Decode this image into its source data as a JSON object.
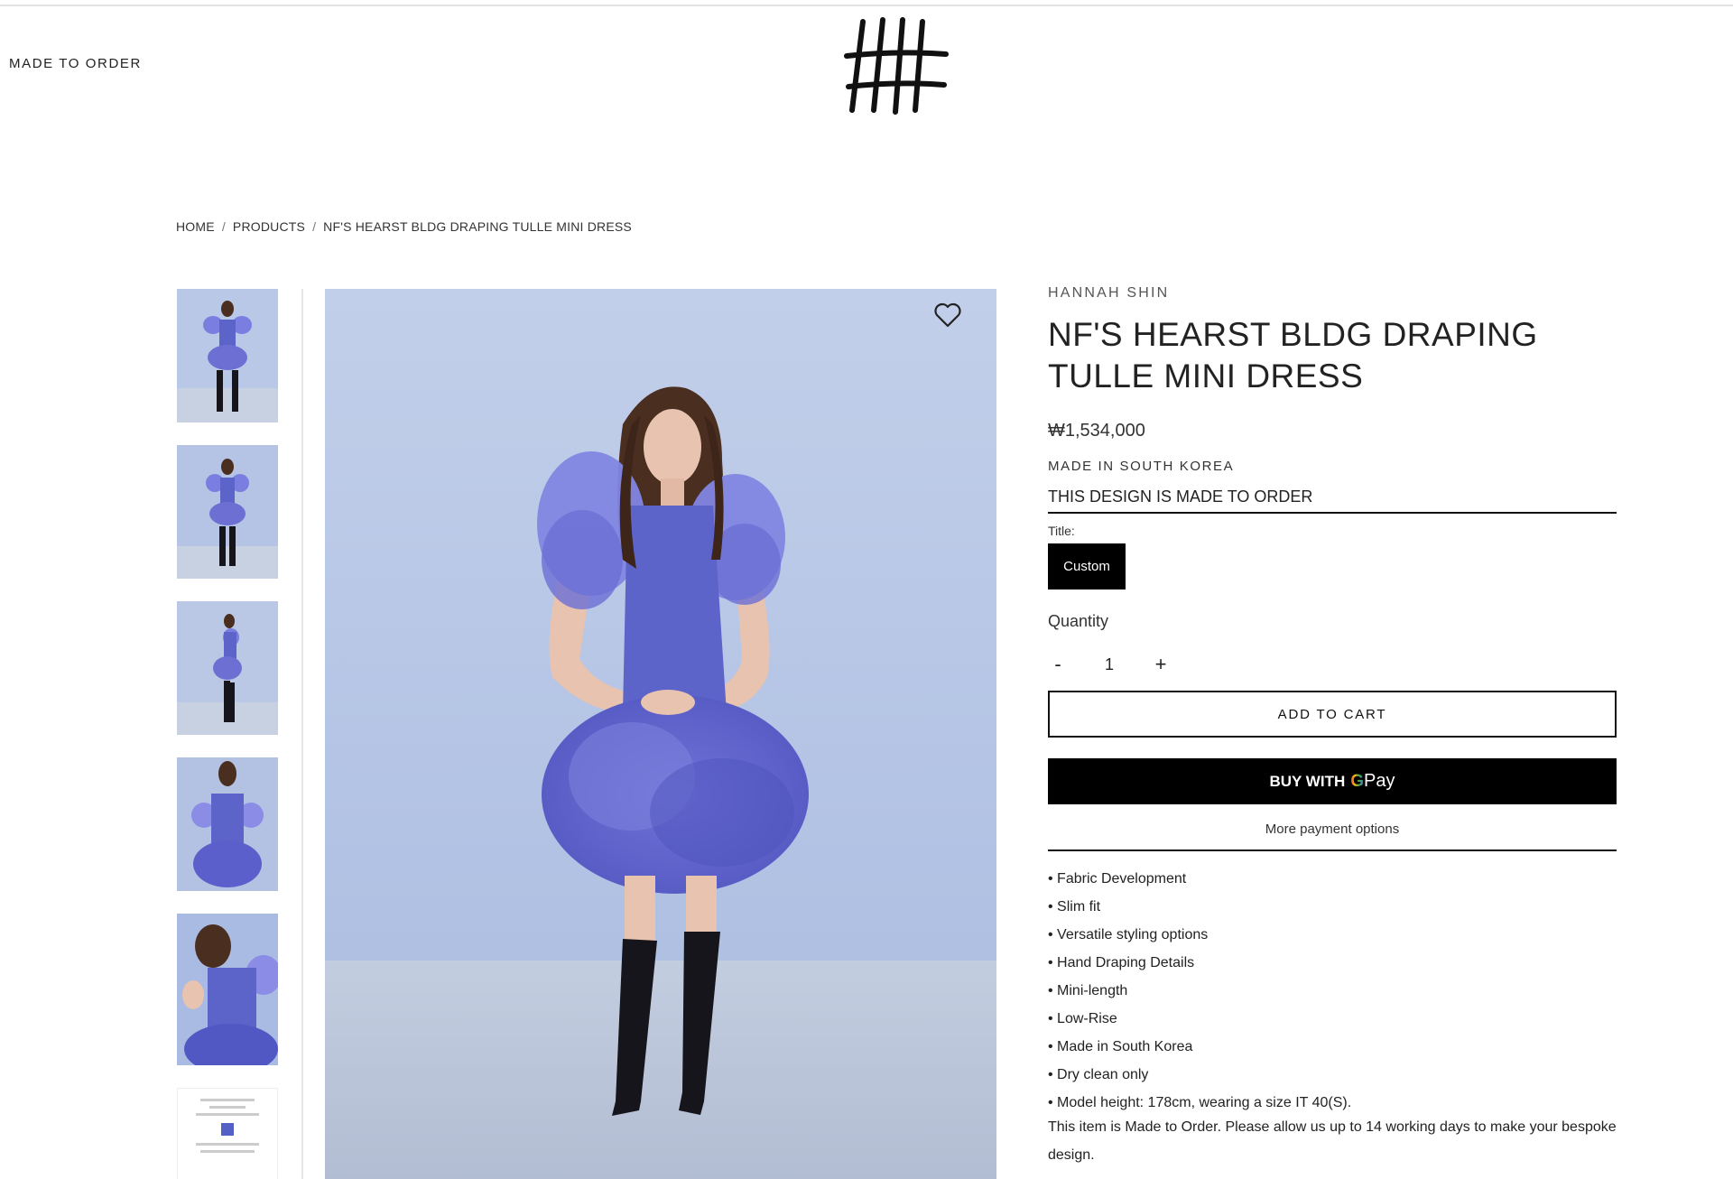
{
  "header": {
    "nav_link": "MADE TO ORDER",
    "logo_name": "brand-logo-hash"
  },
  "breadcrumb": {
    "home": "HOME",
    "sep": "/",
    "products": "PRODUCTS",
    "current": "NF'S HEARST BLDG DRAPING TULLE MINI DRESS"
  },
  "gallery": {
    "thumbnails_count": 6,
    "active_index": 0
  },
  "product": {
    "brand": "HANNAH SHIN",
    "title": "NF'S HEARST BLDG DRAPING TULLE MINI DRESS",
    "price": "₩1,534,000",
    "made_in": "MADE IN SOUTH KOREA",
    "made_to_order": "THIS DESIGN IS MADE TO ORDER",
    "option_label": "Title:",
    "option_value": "Custom",
    "quantity_label": "Quantity",
    "quantity_minus": "-",
    "quantity_value": "1",
    "quantity_plus": "+",
    "add_to_cart": "ADD TO CART",
    "buy_with": "BUY WITH",
    "gpay_g": "G",
    "gpay_pay": "Pay",
    "more_payment": "More payment options",
    "features": [
      "Fabric Development",
      "Slim fit",
      "Versatile styling options",
      "Hand Draping Details",
      "Mini-length",
      "Low-Rise",
      "Made in South Korea",
      "Dry clean only",
      "Model height: 178cm, wearing a size IT 40(S)."
    ],
    "note": "This item is Made to Order. Please allow us up to 14 working days to make your bespoke design."
  },
  "colors": {
    "dress": "#5c63c9",
    "wall": "#b9c8e6",
    "floor": "#c7d1e2",
    "boots": "#15151b",
    "hair": "#4a2e20",
    "skin": "#e8c3b0",
    "gpay_blue": "#4285F4",
    "gpay_red": "#EA4335",
    "gpay_yellow": "#FBBC05",
    "gpay_green": "#34A853"
  }
}
